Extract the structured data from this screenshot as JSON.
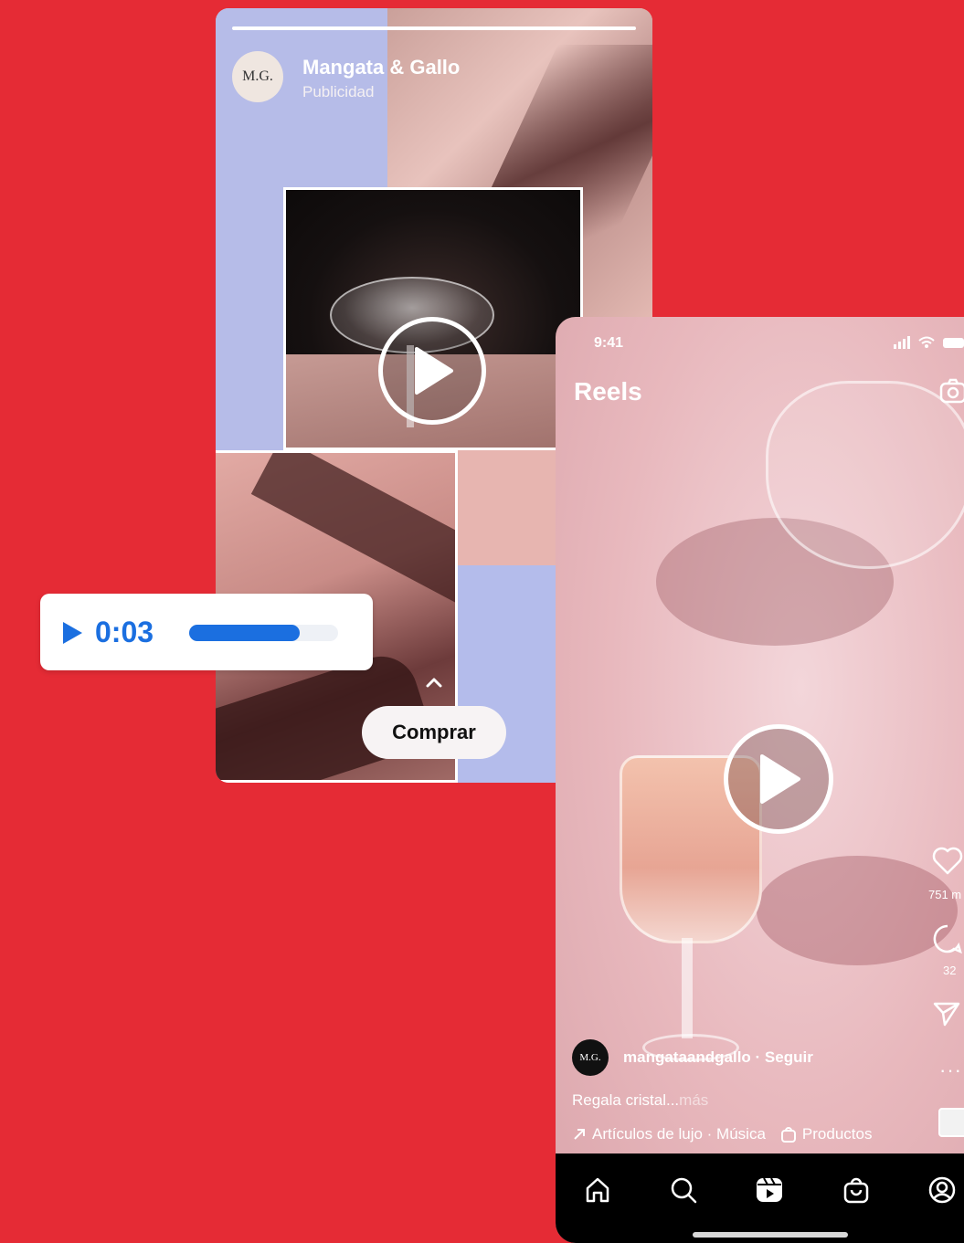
{
  "story": {
    "avatar_text": "M.G.",
    "brand_name": "Mangata & Gallo",
    "sponsored_label": "Publicidad",
    "cta_label": "Comprar"
  },
  "audio": {
    "time": "0:03",
    "progress_fraction": 0.74
  },
  "reels": {
    "status_time": "9:41",
    "title": "Reels",
    "likes": "751 m",
    "comments": "32",
    "avatar_text": "M.G.",
    "account_line": "mangataandgallo · Seguir",
    "caption": "Regala cristal...",
    "caption_more": "más",
    "tag_category": "Artículos de lujo · Música",
    "tag_products": "Productos"
  },
  "colors": {
    "background": "#e52b35",
    "accent_blue": "#1b6fe0",
    "lavender": "#b6bce8"
  },
  "icons": {
    "nav": [
      "home-icon",
      "search-icon",
      "reels-icon",
      "shop-icon",
      "profile-icon"
    ]
  }
}
